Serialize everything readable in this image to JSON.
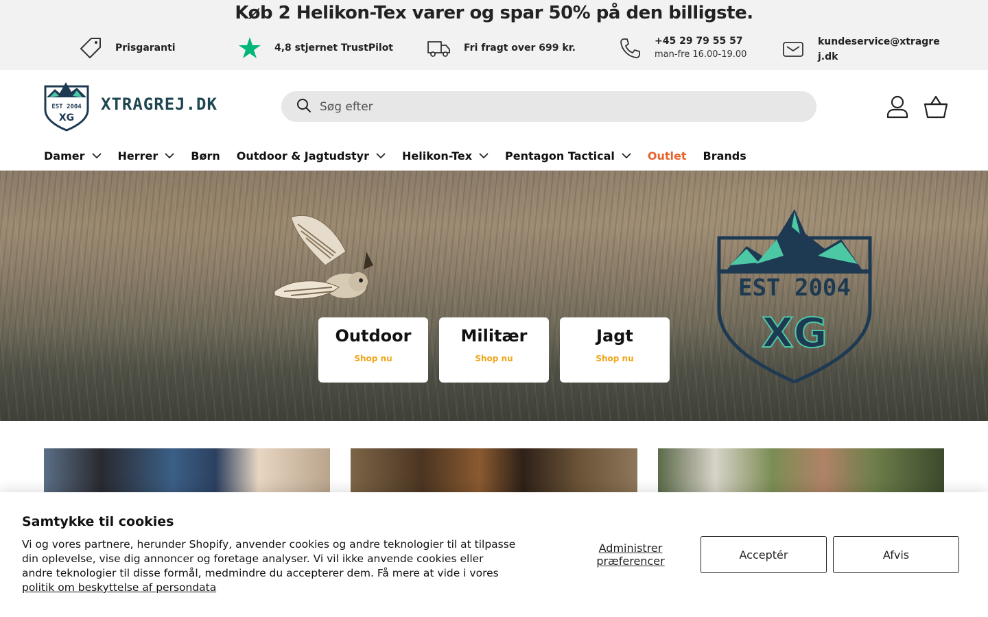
{
  "announcement": "Køb 2 Helikon-Tex varer og spar 50% på den billigste.",
  "usps": [
    {
      "icon": "price-tag-icon",
      "label": "Prisgaranti"
    },
    {
      "icon": "star-icon",
      "label": "4,8 stjernet TrustPilot"
    },
    {
      "icon": "truck-icon",
      "label": "Fri fragt over 699 kr."
    },
    {
      "icon": "phone-icon",
      "label": "+45 29 79 55 57",
      "sub": "man-fre 16.00-19.00"
    },
    {
      "icon": "mail-icon",
      "label": "kundeservice@xtragrej.dk"
    }
  ],
  "header": {
    "logo_badge_text": "EST 2004",
    "logo_monogram": "XG",
    "logo_text": "XTRAGREJ.DK",
    "search_placeholder": "Søg efter"
  },
  "nav": [
    {
      "label": "Damer",
      "dropdown": true
    },
    {
      "label": "Herrer",
      "dropdown": true
    },
    {
      "label": "Børn",
      "dropdown": false
    },
    {
      "label": "Outdoor & Jagtudstyr",
      "dropdown": true
    },
    {
      "label": "Helikon-Tex",
      "dropdown": true
    },
    {
      "label": "Pentagon Tactical",
      "dropdown": true
    },
    {
      "label": "Outlet",
      "dropdown": false
    },
    {
      "label": "Brands",
      "dropdown": false
    }
  ],
  "hero": {
    "badge_text": "EST 2004",
    "badge_monogram": "XG",
    "categories": [
      {
        "title": "Outdoor",
        "cta": "Shop nu"
      },
      {
        "title": "Militær",
        "cta": "Shop nu"
      },
      {
        "title": "Jagt",
        "cta": "Shop nu"
      }
    ]
  },
  "cookie": {
    "title": "Samtykke til cookies",
    "body": "Vi og vores partnere, herunder Shopify, anvender cookies og andre teknologier til at tilpasse din oplevelse, vise dig annoncer og foretage analyser. Vi vil ikke anvende cookies eller andre teknologier til disse formål, medmindre du accepterer dem. Få mere at vide i vores ",
    "link": "politik om beskyttelse af persondata",
    "manage": "Administrer præferencer",
    "accept": "Acceptér",
    "decline": "Afvis"
  },
  "colors": {
    "outlet": "#e8622c",
    "shop_now": "#f0a51a",
    "trustpilot_star": "#00b67a",
    "brand_navy": "#1e3a52",
    "brand_teal": "#4cc9a4"
  }
}
